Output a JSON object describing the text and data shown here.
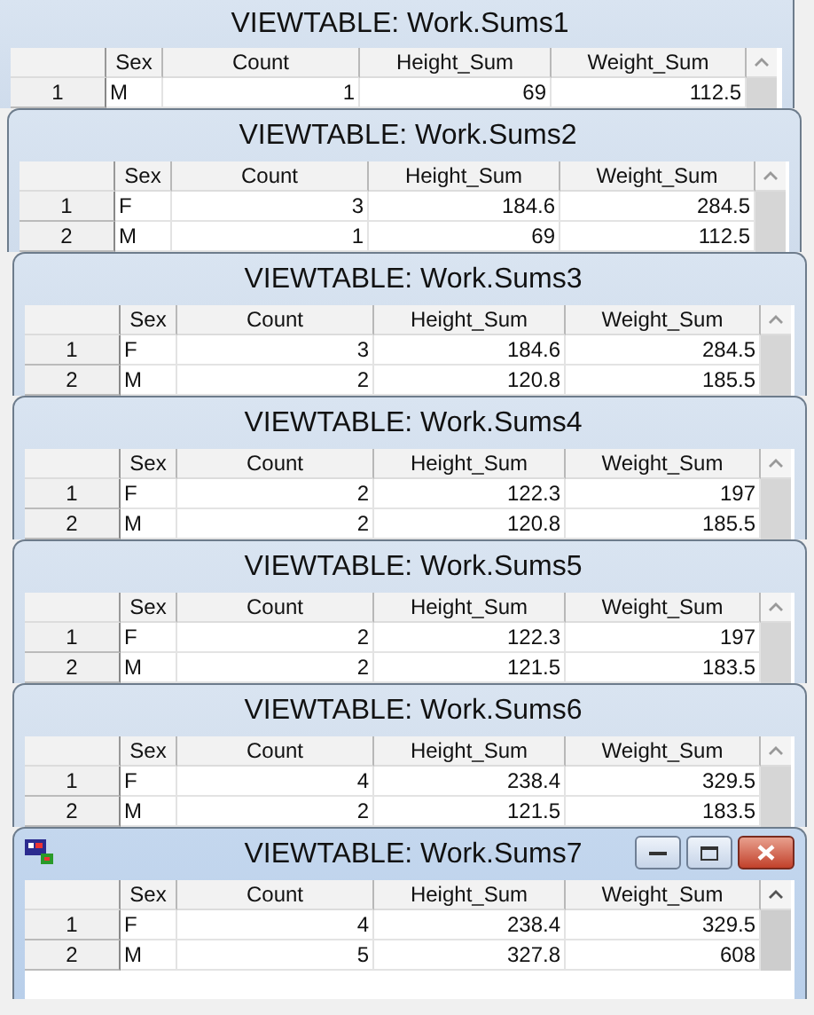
{
  "windows": [
    {
      "title": "VIEWTABLE: Work.Sums1",
      "active": false,
      "columns": [
        "Sex",
        "Count",
        "Height_Sum",
        "Weight_Sum"
      ],
      "rows": [
        {
          "number": "1",
          "sex": "M",
          "count": "1",
          "height_sum": "69",
          "weight_sum": "112.5"
        }
      ]
    },
    {
      "title": "VIEWTABLE: Work.Sums2",
      "active": false,
      "columns": [
        "Sex",
        "Count",
        "Height_Sum",
        "Weight_Sum"
      ],
      "rows": [
        {
          "number": "1",
          "sex": "F",
          "count": "3",
          "height_sum": "184.6",
          "weight_sum": "284.5"
        },
        {
          "number": "2",
          "sex": "M",
          "count": "1",
          "height_sum": "69",
          "weight_sum": "112.5"
        }
      ]
    },
    {
      "title": "VIEWTABLE: Work.Sums3",
      "active": false,
      "columns": [
        "Sex",
        "Count",
        "Height_Sum",
        "Weight_Sum"
      ],
      "rows": [
        {
          "number": "1",
          "sex": "F",
          "count": "3",
          "height_sum": "184.6",
          "weight_sum": "284.5"
        },
        {
          "number": "2",
          "sex": "M",
          "count": "2",
          "height_sum": "120.8",
          "weight_sum": "185.5"
        }
      ]
    },
    {
      "title": "VIEWTABLE: Work.Sums4",
      "active": false,
      "columns": [
        "Sex",
        "Count",
        "Height_Sum",
        "Weight_Sum"
      ],
      "rows": [
        {
          "number": "1",
          "sex": "F",
          "count": "2",
          "height_sum": "122.3",
          "weight_sum": "197"
        },
        {
          "number": "2",
          "sex": "M",
          "count": "2",
          "height_sum": "120.8",
          "weight_sum": "185.5"
        }
      ]
    },
    {
      "title": "VIEWTABLE: Work.Sums5",
      "active": false,
      "columns": [
        "Sex",
        "Count",
        "Height_Sum",
        "Weight_Sum"
      ],
      "rows": [
        {
          "number": "1",
          "sex": "F",
          "count": "2",
          "height_sum": "122.3",
          "weight_sum": "197"
        },
        {
          "number": "2",
          "sex": "M",
          "count": "2",
          "height_sum": "121.5",
          "weight_sum": "183.5"
        }
      ]
    },
    {
      "title": "VIEWTABLE: Work.Sums6",
      "active": false,
      "columns": [
        "Sex",
        "Count",
        "Height_Sum",
        "Weight_Sum"
      ],
      "rows": [
        {
          "number": "1",
          "sex": "F",
          "count": "4",
          "height_sum": "238.4",
          "weight_sum": "329.5"
        },
        {
          "number": "2",
          "sex": "M",
          "count": "2",
          "height_sum": "121.5",
          "weight_sum": "183.5"
        }
      ]
    },
    {
      "title": "VIEWTABLE: Work.Sums7",
      "active": true,
      "columns": [
        "Sex",
        "Count",
        "Height_Sum",
        "Weight_Sum"
      ],
      "rows": [
        {
          "number": "1",
          "sex": "F",
          "count": "4",
          "height_sum": "238.4",
          "weight_sum": "329.5"
        },
        {
          "number": "2",
          "sex": "M",
          "count": "5",
          "height_sum": "327.8",
          "weight_sum": "608"
        }
      ]
    }
  ]
}
